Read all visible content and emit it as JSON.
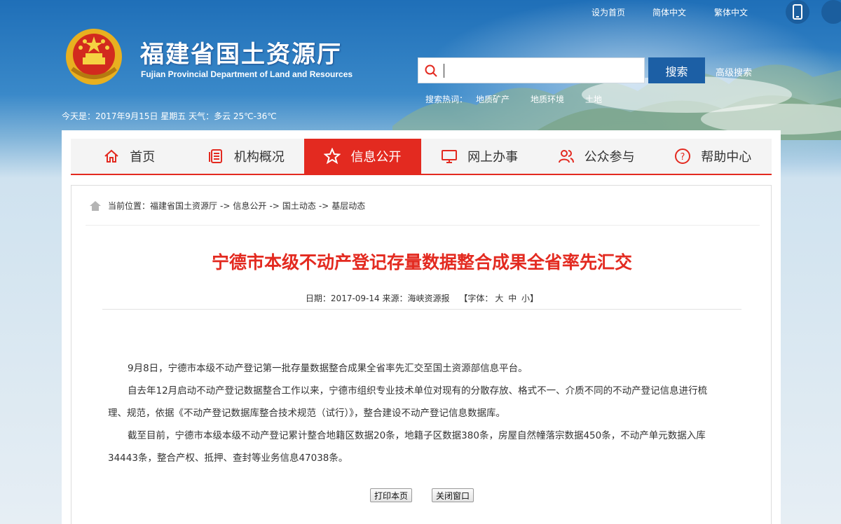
{
  "top_links": [
    "设为首页",
    "简体中文",
    "繁体中文"
  ],
  "site": {
    "title_cn": "福建省国土资源厅",
    "title_en": "Fujian Provincial Department of Land and Resources",
    "today": "今天是：2017年9月15日 星期五 天气：多云 25℃-36℃"
  },
  "search": {
    "placeholder": "",
    "button_label": "搜索",
    "advanced_label": "高级搜索",
    "hot_label": "搜索热词：",
    "hot_words": [
      "地质矿产",
      "地质环境",
      "土地"
    ]
  },
  "nav": {
    "items": [
      {
        "label": "首页",
        "icon": "home-icon"
      },
      {
        "label": "机构概况",
        "icon": "document-icon"
      },
      {
        "label": "信息公开",
        "icon": "star-icon"
      },
      {
        "label": "网上办事",
        "icon": "monitor-icon"
      },
      {
        "label": "公众参与",
        "icon": "people-icon"
      },
      {
        "label": "帮助中心",
        "icon": "question-icon"
      }
    ],
    "active_index": 2
  },
  "breadcrumb": {
    "prefix": "当前位置：",
    "items": [
      "福建省国土资源厅",
      "信息公开",
      "国土动态",
      "基层动态"
    ],
    "separator": "->"
  },
  "article": {
    "title": "宁德市本级不动产登记存量数据整合成果全省率先汇交",
    "meta_date": "日期：2017-09-14",
    "meta_source": "来源：海峡资源报",
    "meta_font_label": "【字体：",
    "meta_font_sizes": [
      "大",
      "中",
      "小"
    ],
    "meta_font_end": "】",
    "paragraphs": [
      "9月8日，宁德市本级不动产登记第一批存量数据整合成果全省率先汇交至国土资源部信息平台。",
      "自去年12月启动不动产登记数据整合工作以来，宁德市组织专业技术单位对现有的分散存放、格式不一、介质不同的不动产登记信息进行梳理、规范，依据《不动产登记数据库整合技术规范（试行）》，整合建设不动产登记信息数据库。",
      "截至目前，宁德市本级本级不动产登记累计整合地籍区数据20条，地籍子区数据380条，房屋自然幢落宗数据450条，不动产单元数据入库34443条，整合产权、抵押、查封等业务信息47038条。"
    ]
  },
  "buttons": {
    "print_label": "打印本页",
    "close_label": "关闭窗口"
  },
  "colors": {
    "accent_red": "#e32a20",
    "brand_blue": "#1c5fa5"
  }
}
